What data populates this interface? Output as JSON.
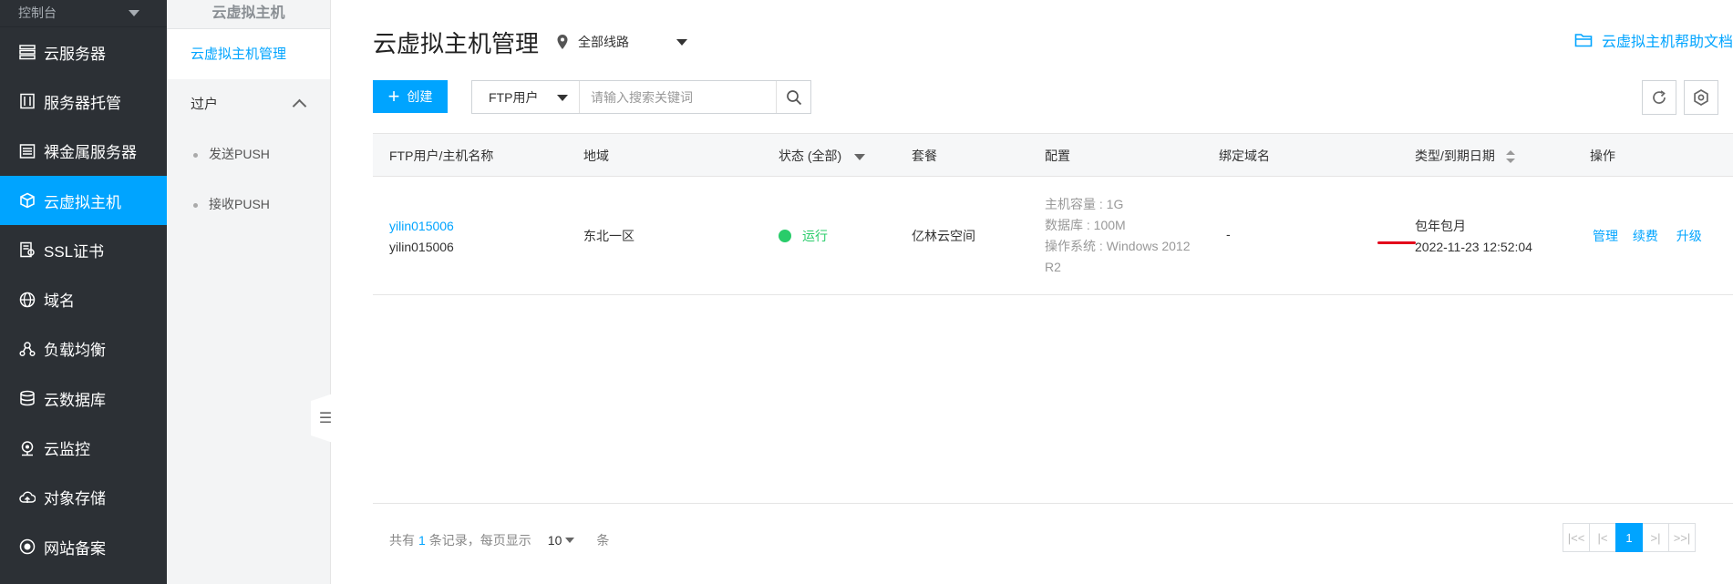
{
  "sidebar": {
    "top_label": "控制台",
    "items": [
      {
        "label": "云服务器",
        "icon": "server-icon"
      },
      {
        "label": "服务器托管",
        "icon": "rack-icon"
      },
      {
        "label": "裸金属服务器",
        "icon": "baremetal-icon"
      },
      {
        "label": "云虚拟主机",
        "icon": "cube-icon",
        "active": true
      },
      {
        "label": "SSL证书",
        "icon": "certificate-icon"
      },
      {
        "label": "域名",
        "icon": "globe-icon"
      },
      {
        "label": "负载均衡",
        "icon": "loadbalancer-icon"
      },
      {
        "label": "云数据库",
        "icon": "database-icon"
      },
      {
        "label": "云监控",
        "icon": "monitor-icon"
      },
      {
        "label": "对象存储",
        "icon": "cloud-upload-icon"
      },
      {
        "label": "网站备案",
        "icon": "record-icon"
      }
    ]
  },
  "submenu": {
    "title": "云虚拟主机",
    "active_item": "云虚拟主机管理",
    "group_label": "过户",
    "sub_items": [
      "发送PUSH",
      "接收PUSH"
    ]
  },
  "header": {
    "title": "云虚拟主机管理",
    "region": "全部线路",
    "help_link": "云虚拟主机帮助文档"
  },
  "toolbar": {
    "create_label": "创建",
    "search_field": "FTP用户",
    "search_placeholder": "请输入搜索关键词"
  },
  "table": {
    "columns": {
      "name": "FTP用户/主机名称",
      "region": "地域",
      "status": "状态 (全部)",
      "package": "套餐",
      "config": "配置",
      "domain": "绑定域名",
      "type_expiry": "类型/到期日期",
      "actions": "操作"
    },
    "rows": [
      {
        "ftp_user": "yilin015006",
        "host_name": "yilin015006",
        "region": "东北一区",
        "status": "运行",
        "package": "亿林云空间",
        "config": {
          "capacity": "主机容量 : 1G",
          "database": "数据库 : 100M",
          "os_line1": "操作系统 : Windows 2012",
          "os_line2": "R2"
        },
        "domain": "-",
        "type": "包年包月",
        "expiry": "2022-11-23 12:52:04",
        "actions": {
          "manage": "管理",
          "renew": "续费",
          "upgrade": "升级"
        }
      }
    ]
  },
  "pagination": {
    "prefix": "共有",
    "total": "1",
    "suffix": "条记录，每页显示",
    "page_size": "10",
    "unit": "条",
    "current_page": "1",
    "first": "|<<",
    "prev": "|<",
    "next": ">|",
    "last": ">>|"
  },
  "colors": {
    "accent": "#00a4ff",
    "sidebar_bg": "#2c3035",
    "running": "#29cc6a",
    "highlight": "#e3001b"
  }
}
